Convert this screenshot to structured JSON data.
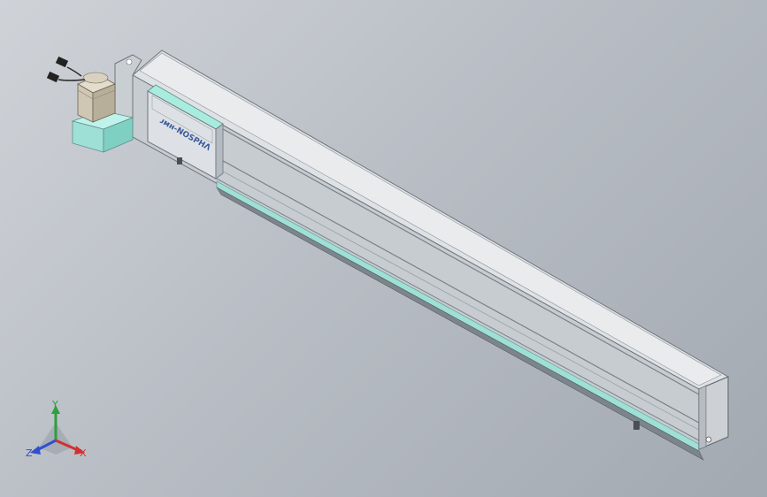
{
  "viewport": {
    "background": "gradient-gray",
    "colors": {
      "rail_body": "#d6dadd",
      "rail_dark": "#8f979e",
      "teal": "#9fe0d6",
      "motor": "#c9c2b2",
      "brand_text": "#3a5a9a"
    }
  },
  "model": {
    "carriage_label": "ᴊᴍʜ-NOSPHɅ",
    "parts": [
      "linear-module-rail",
      "slide-carriage",
      "servo-motor",
      "motor-mount",
      "cable-connectors",
      "end-cap"
    ]
  },
  "triad": {
    "x_label": "X",
    "y_label": "Y",
    "z_label": "Z"
  }
}
